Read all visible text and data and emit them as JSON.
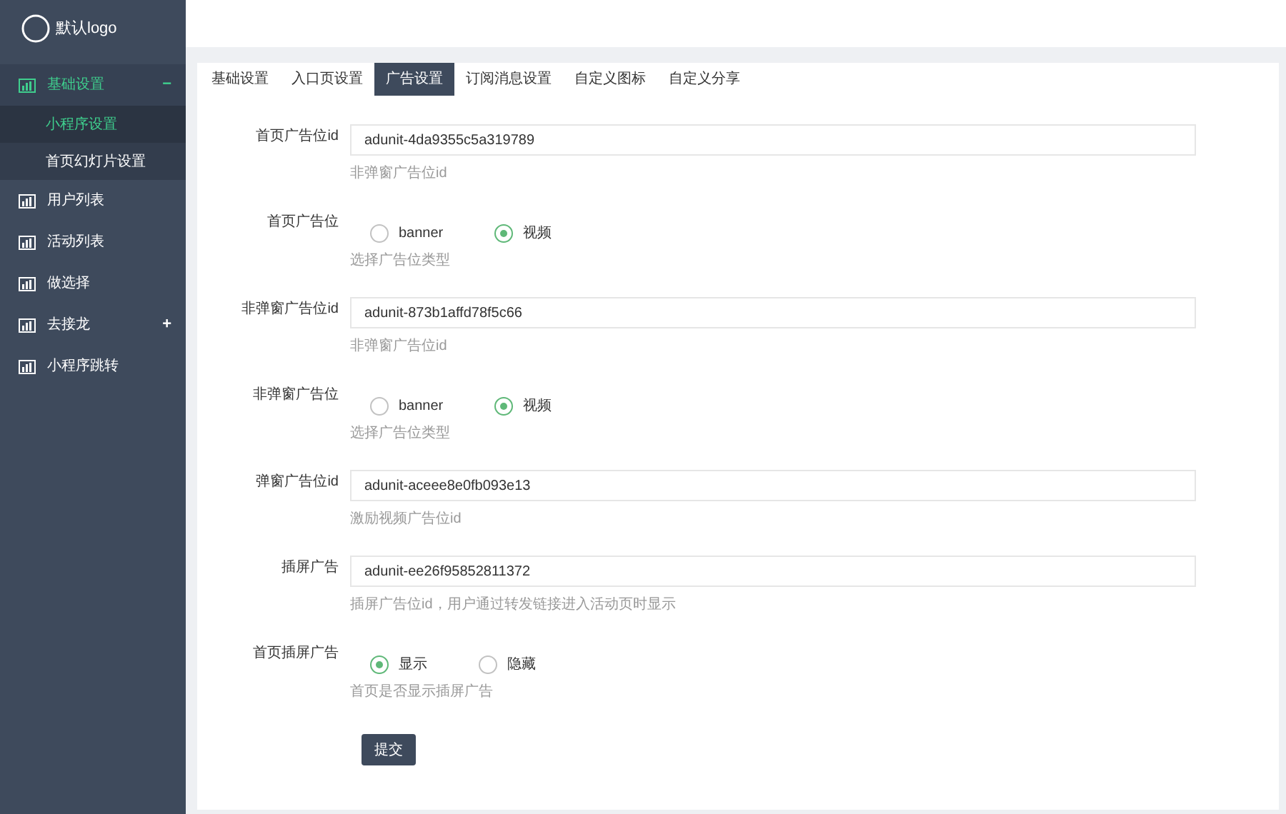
{
  "logo": {
    "text": "默认logo"
  },
  "sidebar": {
    "items": [
      {
        "label": "基础设置",
        "selected": true,
        "expanded": true,
        "toggle": "−",
        "children": [
          {
            "label": "小程序设置",
            "selected": true
          },
          {
            "label": "首页幻灯片设置",
            "selected": false
          }
        ]
      },
      {
        "label": "用户列表",
        "selected": false
      },
      {
        "label": "活动列表",
        "selected": false
      },
      {
        "label": "做选择",
        "selected": false
      },
      {
        "label": "去接龙",
        "selected": false,
        "toggle": "+"
      },
      {
        "label": "小程序跳转",
        "selected": false
      }
    ]
  },
  "tabs": [
    {
      "label": "基础设置",
      "selected": false
    },
    {
      "label": "入口页设置",
      "selected": false
    },
    {
      "label": "广告设置",
      "selected": true
    },
    {
      "label": "订阅消息设置",
      "selected": false
    },
    {
      "label": "自定义图标",
      "selected": false
    },
    {
      "label": "自定义分享",
      "selected": false
    }
  ],
  "form": {
    "fields": [
      {
        "kind": "text",
        "label": "首页广告位id",
        "value": "adunit-4da9355c5a319789",
        "help": "非弹窗广告位id"
      },
      {
        "kind": "radio",
        "label": "首页广告位",
        "options": [
          {
            "label": "banner",
            "selected": false
          },
          {
            "label": "视频",
            "selected": true
          }
        ],
        "help": "选择广告位类型"
      },
      {
        "kind": "text",
        "label": "非弹窗广告位id",
        "value": "adunit-873b1affd78f5c66",
        "help": "非弹窗广告位id"
      },
      {
        "kind": "radio",
        "label": "非弹窗广告位",
        "options": [
          {
            "label": "banner",
            "selected": false
          },
          {
            "label": "视频",
            "selected": true
          }
        ],
        "help": "选择广告位类型"
      },
      {
        "kind": "text",
        "label": "弹窗广告位id",
        "value": "adunit-aceee8e0fb093e13",
        "help": "激励视频广告位id"
      },
      {
        "kind": "text",
        "label": "插屏广告",
        "value": "adunit-ee26f95852811372",
        "help": "插屏广告位id，用户通过转发链接进入活动页时显示"
      },
      {
        "kind": "radio",
        "label": "首页插屏广告",
        "options": [
          {
            "label": "显示",
            "selected": true
          },
          {
            "label": "隐藏",
            "selected": false
          }
        ],
        "help": "首页是否显示插屏广告"
      }
    ],
    "submit": "提交"
  }
}
